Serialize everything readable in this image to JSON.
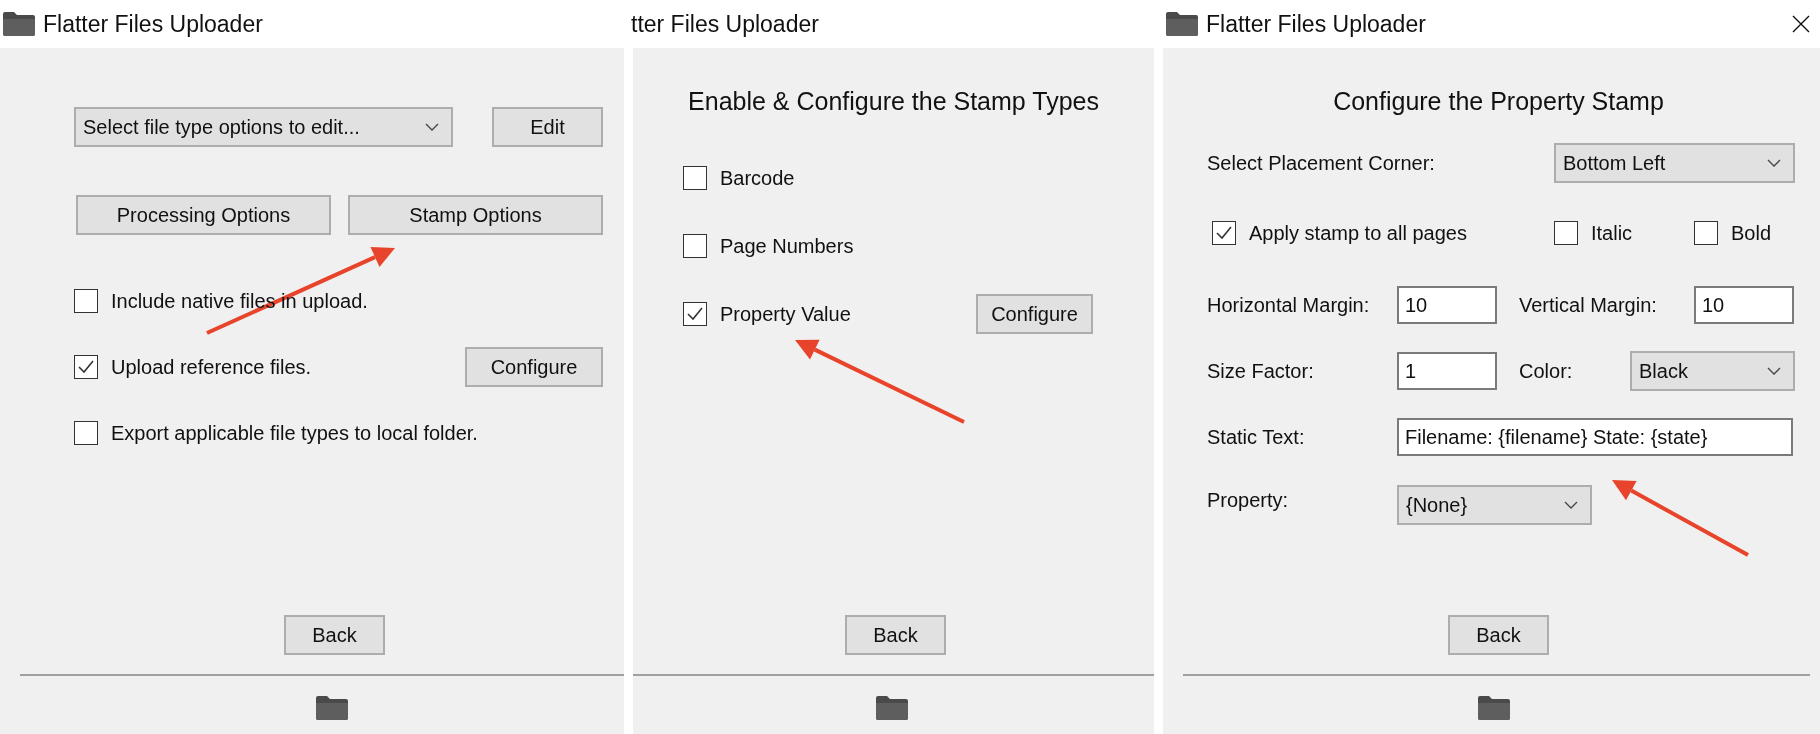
{
  "windows": [
    {
      "title": "Flatter Files Uploader",
      "file_type_select": {
        "value": "Select file type options to edit..."
      },
      "edit_button": "Edit",
      "option_buttons": [
        "Processing Options",
        "Stamp Options"
      ],
      "options": [
        {
          "label": "Include native files in upload.",
          "checked": false
        },
        {
          "label": "Upload reference files.",
          "checked": true,
          "button": "Configure"
        },
        {
          "label": "Export applicable file types to local folder.",
          "checked": false
        }
      ],
      "back_button": "Back"
    },
    {
      "title": "tter Files Uploader",
      "heading": "Enable & Configure the Stamp Types",
      "stamp_types": [
        {
          "label": "Barcode",
          "checked": false
        },
        {
          "label": "Page Numbers",
          "checked": false
        },
        {
          "label": "Property Value",
          "checked": true,
          "button": "Configure"
        }
      ],
      "back_button": "Back"
    },
    {
      "title": "Flatter Files Uploader",
      "heading": "Configure the Property Stamp",
      "placement_corner": {
        "label": "Select Placement Corner:",
        "value": "Bottom Left"
      },
      "apply_all_pages": {
        "label": "Apply stamp to all pages",
        "checked": true
      },
      "italic": {
        "label": "Italic",
        "checked": false
      },
      "bold": {
        "label": "Bold",
        "checked": false
      },
      "horizontal_margin": {
        "label": "Horizontal Margin:",
        "value": "10"
      },
      "vertical_margin": {
        "label": "Vertical Margin:",
        "value": "10"
      },
      "size_factor": {
        "label": "Size Factor:",
        "value": "1"
      },
      "color": {
        "label": "Color:",
        "value": "Black"
      },
      "static_text": {
        "label": "Static Text:",
        "value": "Filename: {filename} State: {state}"
      },
      "property": {
        "label": "Property:",
        "value": "{None}"
      },
      "back_button": "Back"
    }
  ]
}
